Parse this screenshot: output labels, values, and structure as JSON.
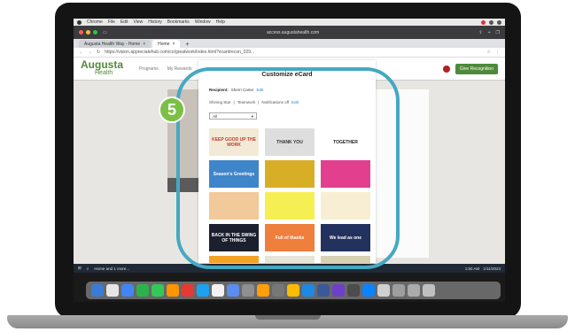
{
  "menubar": {
    "items": [
      "Chrome",
      "File",
      "Edit",
      "View",
      "History",
      "Bookmarks",
      "Window",
      "Help"
    ]
  },
  "safari": {
    "url": "access.augustahealth.com"
  },
  "tabs": [
    {
      "label": "Augusta Health Way - Home",
      "active": false
    },
    {
      "label": "Home",
      "active": true
    }
  ],
  "address": {
    "url": "https://vision.appreciatehub.com/co/greatwork/index.html?ecardrecon_029..."
  },
  "app": {
    "logo_main": "Augusta",
    "logo_sub": "Health",
    "nav": [
      "Programs",
      "My Rewards"
    ],
    "give_button": "Give Recognition"
  },
  "modal": {
    "title": "Customize eCard",
    "recipients_label": "Recipient:",
    "recipients_value": "Sherri Carter",
    "edit": "Edit",
    "values": [
      "Shining Star",
      "Teamwork",
      "Notifications off"
    ],
    "category_select": "All",
    "cards": [
      {
        "text": "KEEP GOOD UP THE WORK",
        "bg": "#f2ead7",
        "fg": "#c0392b"
      },
      {
        "text": "THANK YOU",
        "bg": "#dedede",
        "fg": "#333333"
      },
      {
        "text": "TOGETHER",
        "bg": "#ffffff",
        "fg": "#222222"
      },
      {
        "text": "Season's Greetings",
        "bg": "#3f85c9",
        "fg": "#ffffff"
      },
      {
        "text": "",
        "bg": "#d9ae27",
        "fg": "#ffffff"
      },
      {
        "text": "",
        "bg": "#e23f8f",
        "fg": "#ffffff"
      },
      {
        "text": "",
        "bg": "#f2c99a",
        "fg": "#b03a2e"
      },
      {
        "text": "",
        "bg": "#f5ef54",
        "fg": "#333333"
      },
      {
        "text": "",
        "bg": "#f7eed3",
        "fg": "#8b6a2a"
      },
      {
        "text": "BACK IN THE SWING OF THINGS",
        "bg": "#1b1f2e",
        "fg": "#ffffff"
      },
      {
        "text": "Full of thanks",
        "bg": "#ee7f3d",
        "fg": "#ffffff"
      },
      {
        "text": "We lead as one",
        "bg": "#23315e",
        "fg": "#ffffff"
      },
      {
        "text": "",
        "bg": "#f3a227",
        "fg": "#ffffff"
      },
      {
        "text": "",
        "bg": "#e7e4d8",
        "fg": "#333333"
      },
      {
        "text": "",
        "bg": "#d7d1b3",
        "fg": "#333333"
      }
    ]
  },
  "taskbar": {
    "items": [
      "Home and 1 more..."
    ],
    "time": "1:50 AM",
    "date": "1/11/2023"
  },
  "step": {
    "number": "5"
  },
  "colors": {
    "highlight": "#46a8c2",
    "step_badge": "#7bc045",
    "brand_green": "#4e8a3a"
  }
}
